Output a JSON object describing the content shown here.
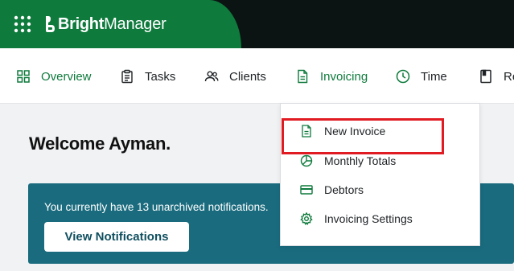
{
  "brand": {
    "bold": "Bright",
    "light": "Manager",
    "color": "#0e7a3c"
  },
  "nav": {
    "items": [
      {
        "label": "Overview",
        "icon": "grid-icon",
        "active": true
      },
      {
        "label": "Tasks",
        "icon": "clipboard-icon"
      },
      {
        "label": "Clients",
        "icon": "users-icon"
      },
      {
        "label": "Invoicing",
        "icon": "document-icon",
        "active": true
      },
      {
        "label": "Time",
        "icon": "clock-icon"
      },
      {
        "label": "Re",
        "icon": "report-icon"
      }
    ]
  },
  "main": {
    "welcome": "Welcome Ayman.",
    "notice_text": "You currently have 13 unarchived notifications.",
    "notice_button": "View Notifications",
    "notice_color": "#1a6b7e"
  },
  "dropdown": {
    "items": [
      {
        "label": "New Invoice",
        "icon": "invoice-icon"
      },
      {
        "label": "Monthly Totals",
        "icon": "pie-chart-icon"
      },
      {
        "label": "Debtors",
        "icon": "credit-card-icon"
      },
      {
        "label": "Invoicing Settings",
        "icon": "settings-gear-icon"
      }
    ],
    "highlight_color": "#e11b22"
  }
}
